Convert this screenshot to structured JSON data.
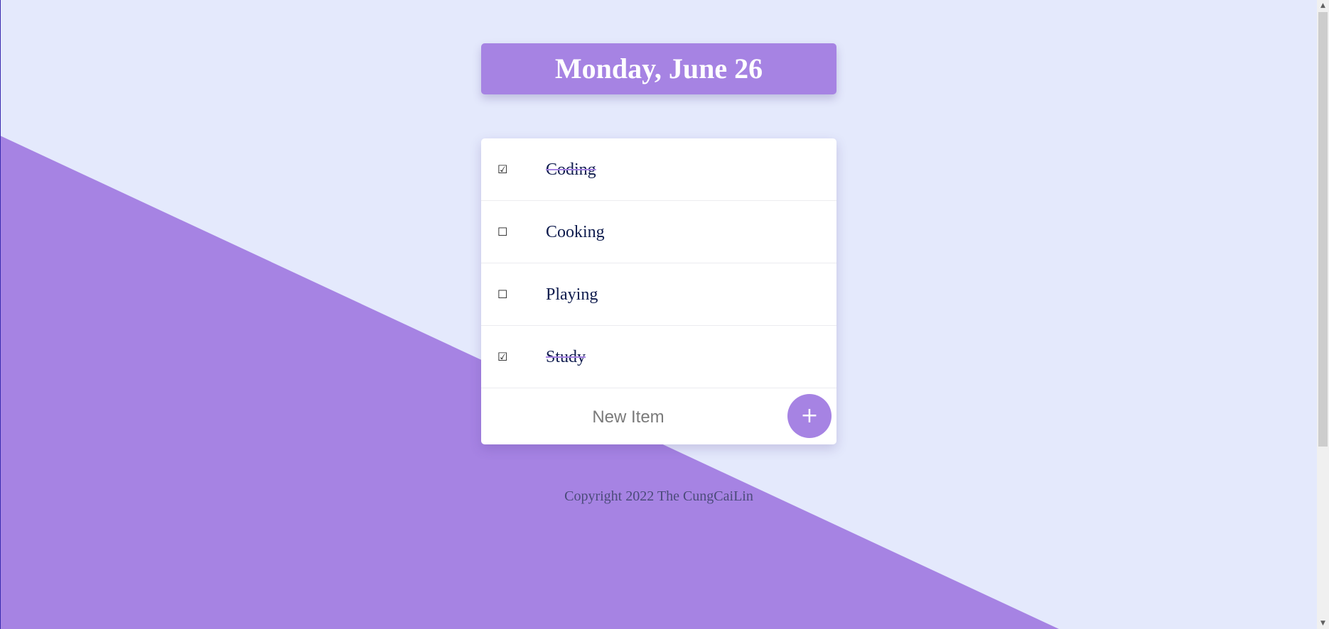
{
  "colors": {
    "background": "#E4E9FC",
    "accent": "#A683E3",
    "item_text": "#0E1B4D",
    "footer_text": "#4B4B7A"
  },
  "header": {
    "date": "Monday, June 26"
  },
  "todos": [
    {
      "text": "Coding",
      "checked": true,
      "checkbox_icon": "☑"
    },
    {
      "text": "Cooking",
      "checked": false,
      "checkbox_icon": "☐"
    },
    {
      "text": "Playing",
      "checked": false,
      "checkbox_icon": "☐"
    },
    {
      "text": "Study",
      "checked": true,
      "checkbox_icon": "☑"
    }
  ],
  "new_item": {
    "placeholder": "New Item",
    "value": "",
    "add_label": "+"
  },
  "footer": {
    "copyright": "Copyright 2022 The CungCaiLin"
  }
}
